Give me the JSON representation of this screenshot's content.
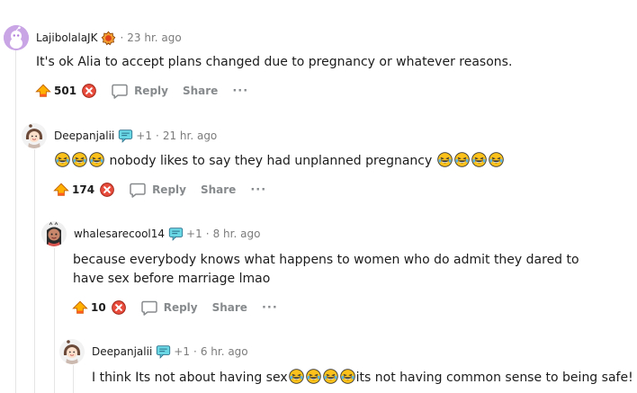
{
  "colors": {
    "upvote": "#ff7c00",
    "downvote": "#e74c3c",
    "meta": "#7c7c7c",
    "action": "#878a8c",
    "thread": "#e5e5e5"
  },
  "actions": {
    "reply": "Reply",
    "share": "Share",
    "more": "···"
  },
  "comments": [
    {
      "author": "LajibolalaJK",
      "time": "23 hr. ago",
      "body": "It's ok Alia to accept plans changed due to pregnancy or whatever reasons.",
      "score": "501",
      "avatar_icon": "snoo-avatar-icon",
      "flair_icon": "award-flair-icon"
    },
    {
      "author": "Deepanjalii",
      "plus": "+1",
      "time": "21 hr. ago",
      "body_text": "nobody likes to say they had unplanned pregnancy",
      "score": "174",
      "avatar_icon": "girl-avatar-icon",
      "flair_icon": "chat-flair-icon",
      "emoji_icon": "laughing-tears-emoji-icon"
    },
    {
      "author": "whalesarecool14",
      "plus": "+1",
      "time": "8 hr. ago",
      "body": "because everybody knows what happens to women who do admit they dared to have sex before marriage lmao",
      "score": "10",
      "avatar_icon": "cartoon-avatar-icon",
      "flair_icon": "chat-flair-icon"
    },
    {
      "author": "Deepanjalii",
      "plus": "+1",
      "time": "6 hr. ago",
      "body_part1": "I think Its not about having sex",
      "body_part2": "its not having common sense to being safe! I",
      "avatar_icon": "girl-avatar-icon",
      "flair_icon": "chat-flair-icon",
      "emoji_icon": "laughing-tears-emoji-icon"
    }
  ]
}
